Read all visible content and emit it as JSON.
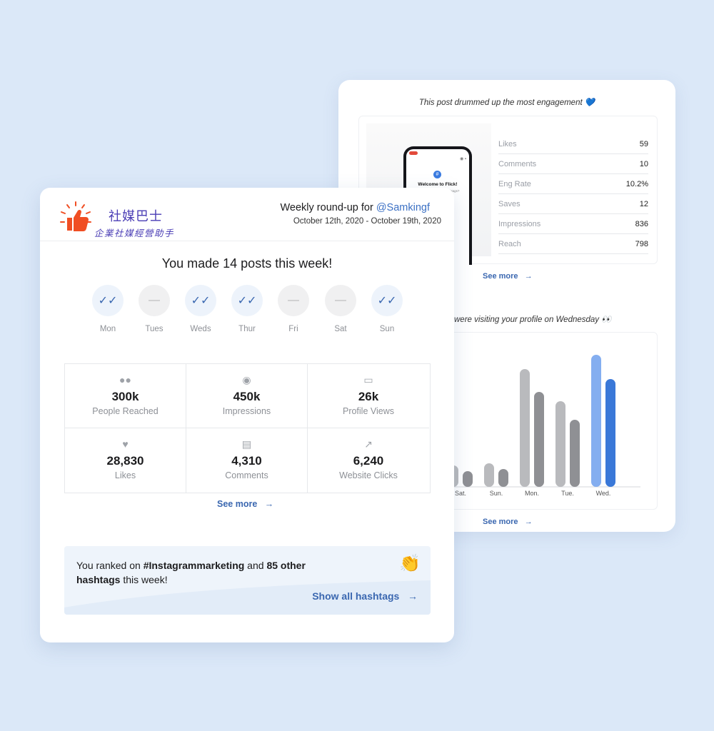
{
  "back_card": {
    "engagement_title": "This post drummed up the most engagement 💙",
    "phone": {
      "welcome": "Welcome to Flick!",
      "sub": "Ready to find some hashtags?"
    },
    "stats": [
      {
        "label": "Likes",
        "value": "59"
      },
      {
        "label": "Comments",
        "value": "10"
      },
      {
        "label": "Eng Rate",
        "value": "10.2%"
      },
      {
        "label": "Saves",
        "value": "12"
      },
      {
        "label": "Impressions",
        "value": "836"
      },
      {
        "label": "Reach",
        "value": "798"
      }
    ],
    "see_more_1": "See more",
    "visit_title": "were visiting your profile on Wednesday 👀",
    "see_more_2": "See more"
  },
  "chart_data": {
    "type": "bar",
    "categories": [
      "Sat.",
      "Sun.",
      "Mon.",
      "Tue.",
      "Wed."
    ],
    "series": [
      {
        "values": [
          30,
          33,
          165,
          120,
          185
        ]
      },
      {
        "values": [
          22,
          25,
          133,
          94,
          151
        ]
      }
    ],
    "ylim": [
      0,
      200
    ],
    "colors": {
      "default": [
        "#b9babd",
        "#8f9094"
      ],
      "highlight": [
        "#84aef0",
        "#3a78d8"
      ]
    },
    "highlight_index": 4,
    "grid": false
  },
  "front_card": {
    "logo_title": "社媒巴士",
    "logo_sub": "企業社媒經營助手",
    "roundup_prefix": "Weekly round-up for ",
    "handle": "@Samkingf",
    "dates": "October 12th, 2020 - October 19th, 2020",
    "headline": "You made 14 posts  this week!",
    "days": [
      {
        "label": "Mon",
        "active": true
      },
      {
        "label": "Tues",
        "active": false
      },
      {
        "label": "Weds",
        "active": true
      },
      {
        "label": "Thur",
        "active": true
      },
      {
        "label": "Fri",
        "active": false
      },
      {
        "label": "Sat",
        "active": false
      },
      {
        "label": "Sun",
        "active": true
      }
    ],
    "metrics": [
      {
        "icon": "people-icon",
        "value": "300k",
        "label": "People Reached"
      },
      {
        "icon": "eye-icon",
        "value": "450k",
        "label": "Impressions"
      },
      {
        "icon": "profile-icon",
        "value": "26k",
        "label": "Profile Views"
      },
      {
        "icon": "heart-icon",
        "value": "28,830",
        "label": "Likes"
      },
      {
        "icon": "comment-icon",
        "value": "4,310",
        "label": "Comments"
      },
      {
        "icon": "arrow-up-right-icon",
        "value": "6,240",
        "label": "Website Clicks"
      }
    ],
    "see_more": "See more",
    "hashtag": {
      "prefix": "You ranked on ",
      "tag": "#Instagrammarketing",
      "middle": " and ",
      "count": "85 other hashtags",
      "suffix": " this week!",
      "emoji": "👏",
      "show_all": "Show all hashtags"
    }
  }
}
